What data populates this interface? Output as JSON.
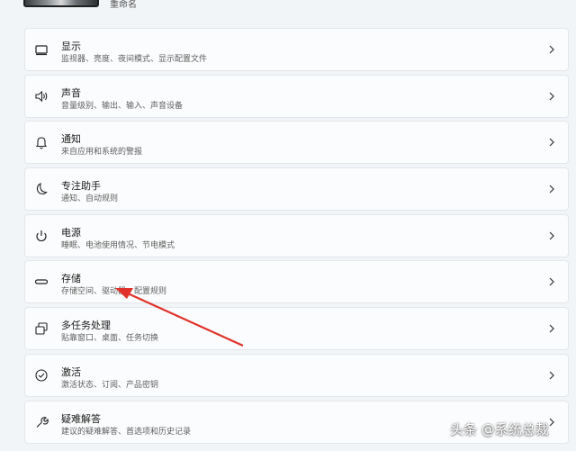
{
  "header": {
    "rename_label": "重命名"
  },
  "items": [
    {
      "title": "显示",
      "subtitle": "监视器、亮度、夜间模式、显示配置文件",
      "icon": "monitor-icon"
    },
    {
      "title": "声音",
      "subtitle": "音量级别、输出、输入、声音设备",
      "icon": "speaker-icon"
    },
    {
      "title": "通知",
      "subtitle": "来自应用和系统的警报",
      "icon": "bell-icon"
    },
    {
      "title": "专注助手",
      "subtitle": "通知、自动规则",
      "icon": "moon-icon"
    },
    {
      "title": "电源",
      "subtitle": "睡眠、电池使用情况、节电模式",
      "icon": "power-icon"
    },
    {
      "title": "存储",
      "subtitle": "存储空间、驱动器、配置规则",
      "icon": "storage-icon"
    },
    {
      "title": "多任务处理",
      "subtitle": "贴靠窗口、桌面、任务切换",
      "icon": "multitask-icon"
    },
    {
      "title": "激活",
      "subtitle": "激活状态、订阅、产品密钥",
      "icon": "check-circle-icon"
    },
    {
      "title": "疑难解答",
      "subtitle": "建议的疑难解答、首选项和历史记录",
      "icon": "wrench-icon"
    }
  ],
  "annotation": {
    "arrow_color": "#e0322b"
  },
  "watermark": {
    "text": "头条 @系统总裁"
  }
}
